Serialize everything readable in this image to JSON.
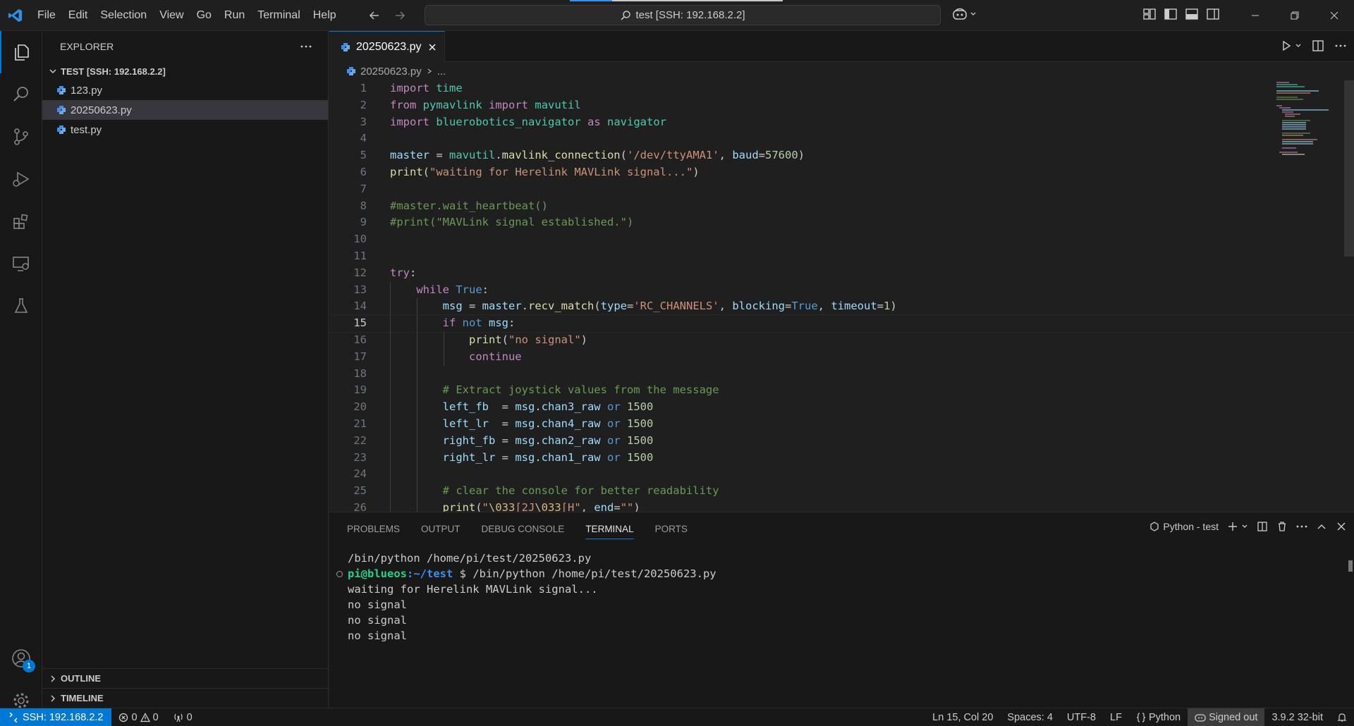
{
  "titlebar": {
    "menu": [
      "File",
      "Edit",
      "Selection",
      "View",
      "Go",
      "Run",
      "Terminal",
      "Help"
    ],
    "search": "test [SSH: 192.168.2.2]"
  },
  "sidebar": {
    "header": "EXPLORER",
    "folder": "TEST [SSH: 192.168.2.2]",
    "files": [
      "123.py",
      "20250623.py",
      "test.py"
    ],
    "outline": "OUTLINE",
    "timeline": "TIMELINE"
  },
  "activity": {
    "accounts_badge": "1"
  },
  "editor": {
    "tab": "20250623.py",
    "breadcrumb_file": "20250623.py",
    "breadcrumb_more": "...",
    "current_line": 15
  },
  "panel": {
    "tabs": [
      "PROBLEMS",
      "OUTPUT",
      "DEBUG CONSOLE",
      "TERMINAL",
      "PORTS"
    ],
    "active_tab": "TERMINAL",
    "shell": "Python - test",
    "cmd_line": "/bin/python /home/pi/test/20250623.py",
    "prompt_user": "pi@blueos",
    "prompt_path": ":~/test",
    "prompt_symbol": " $ ",
    "prompt_cmd": "/bin/python /home/pi/test/20250623.py",
    "output": [
      "waiting for Herelink MAVLink signal...",
      "no signal",
      "no signal",
      "no signal"
    ]
  },
  "status": {
    "remote": "SSH: 192.168.2.2",
    "errors": "0",
    "warnings": "0",
    "ports": "0",
    "position": "Ln 15, Col 20",
    "spaces": "Spaces: 4",
    "encoding": "UTF-8",
    "eol": "LF",
    "language": "Python",
    "signed": "Signed out",
    "interpreter": "3.9.2 32-bit"
  },
  "colors": {
    "accent": "#0078d4",
    "background": "#1f1f1f",
    "sidebar": "#181818"
  }
}
